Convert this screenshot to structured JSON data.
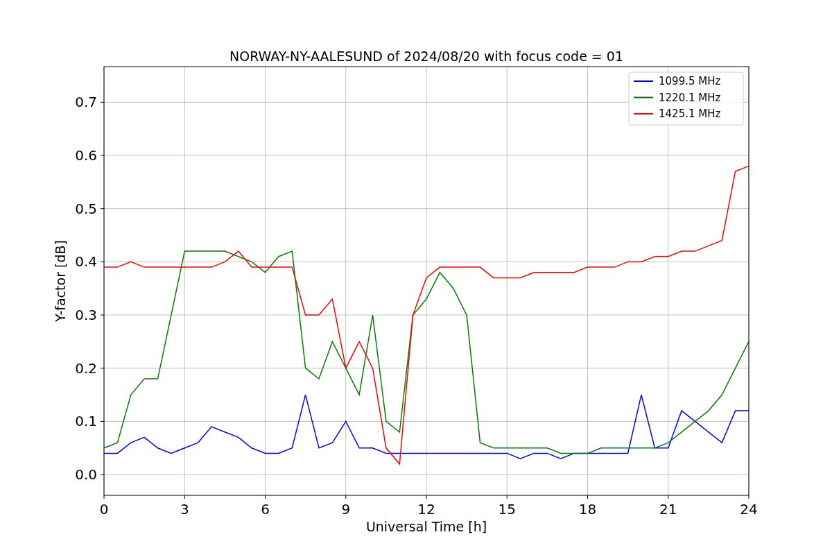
{
  "chart_data": {
    "type": "line",
    "title": "NORWAY-NY-AALESUND of 2024/08/20 with focus code = 01",
    "xlabel": "Universal Time [h]",
    "ylabel": "Y-factor [dB]",
    "x": [
      0,
      0.5,
      1,
      1.5,
      2,
      2.5,
      3,
      3.5,
      4,
      4.5,
      5,
      5.5,
      6,
      6.5,
      7,
      7.5,
      8,
      8.5,
      9,
      9.5,
      10,
      10.5,
      11,
      11.5,
      12,
      12.5,
      13,
      13.5,
      14,
      14.5,
      15,
      15.5,
      16,
      16.5,
      17,
      17.5,
      18,
      18.5,
      19,
      19.5,
      20,
      20.5,
      21,
      21.5,
      22,
      22.5,
      23,
      23.5,
      24
    ],
    "series": [
      {
        "name": "1099.5 MHz",
        "color": "#0000ff",
        "values": [
          0.04,
          0.04,
          0.06,
          0.07,
          0.05,
          0.04,
          0.05,
          0.06,
          0.09,
          0.08,
          0.07,
          0.05,
          0.04,
          0.04,
          0.05,
          0.15,
          0.05,
          0.06,
          0.1,
          0.05,
          0.05,
          0.04,
          0.04,
          0.04,
          0.04,
          0.04,
          0.04,
          0.04,
          0.04,
          0.04,
          0.04,
          0.03,
          0.04,
          0.04,
          0.03,
          0.04,
          0.04,
          0.04,
          0.04,
          0.04,
          0.15,
          0.05,
          0.05,
          0.12,
          0.1,
          0.08,
          0.06,
          0.12,
          0.12
        ]
      },
      {
        "name": "1220.1 MHz",
        "color": "#008000",
        "values": [
          0.05,
          0.06,
          0.15,
          0.18,
          0.18,
          0.3,
          0.42,
          0.42,
          0.42,
          0.42,
          0.41,
          0.4,
          0.38,
          0.41,
          0.42,
          0.2,
          0.18,
          0.25,
          0.2,
          0.15,
          0.3,
          0.1,
          0.08,
          0.3,
          0.33,
          0.38,
          0.35,
          0.3,
          0.06,
          0.05,
          0.05,
          0.05,
          0.05,
          0.05,
          0.04,
          0.04,
          0.04,
          0.05,
          0.05,
          0.05,
          0.05,
          0.05,
          0.06,
          0.08,
          0.1,
          0.12,
          0.15,
          0.2,
          0.25
        ]
      },
      {
        "name": "1425.1 MHz",
        "color": "#ff0000",
        "values": [
          0.39,
          0.39,
          0.4,
          0.39,
          0.39,
          0.39,
          0.39,
          0.39,
          0.39,
          0.4,
          0.42,
          0.39,
          0.39,
          0.39,
          0.39,
          0.3,
          0.3,
          0.33,
          0.2,
          0.25,
          0.2,
          0.05,
          0.02,
          0.3,
          0.37,
          0.39,
          0.39,
          0.39,
          0.39,
          0.37,
          0.37,
          0.37,
          0.38,
          0.38,
          0.38,
          0.38,
          0.39,
          0.39,
          0.39,
          0.4,
          0.4,
          0.41,
          0.41,
          0.42,
          0.42,
          0.43,
          0.44,
          0.57,
          0.58
        ]
      }
    ],
    "grid": true,
    "legend": true,
    "xlim": [
      0,
      24
    ],
    "ylim": [
      -0.039,
      0.767
    ],
    "xticks": [
      0,
      3,
      6,
      9,
      12,
      15,
      18,
      21,
      24
    ],
    "yticks": [
      {
        "value": 0,
        "label": "0.0"
      },
      {
        "value": 0.1,
        "label": "0.1"
      },
      {
        "value": 0.2,
        "label": "0.2"
      },
      {
        "value": 0.3,
        "label": "0.3"
      },
      {
        "value": 0.4,
        "label": "0.4"
      },
      {
        "value": 0.5,
        "label": "0.5"
      },
      {
        "value": 0.6,
        "label": "0.6"
      },
      {
        "value": 0.7,
        "label": "0.7"
      }
    ]
  }
}
